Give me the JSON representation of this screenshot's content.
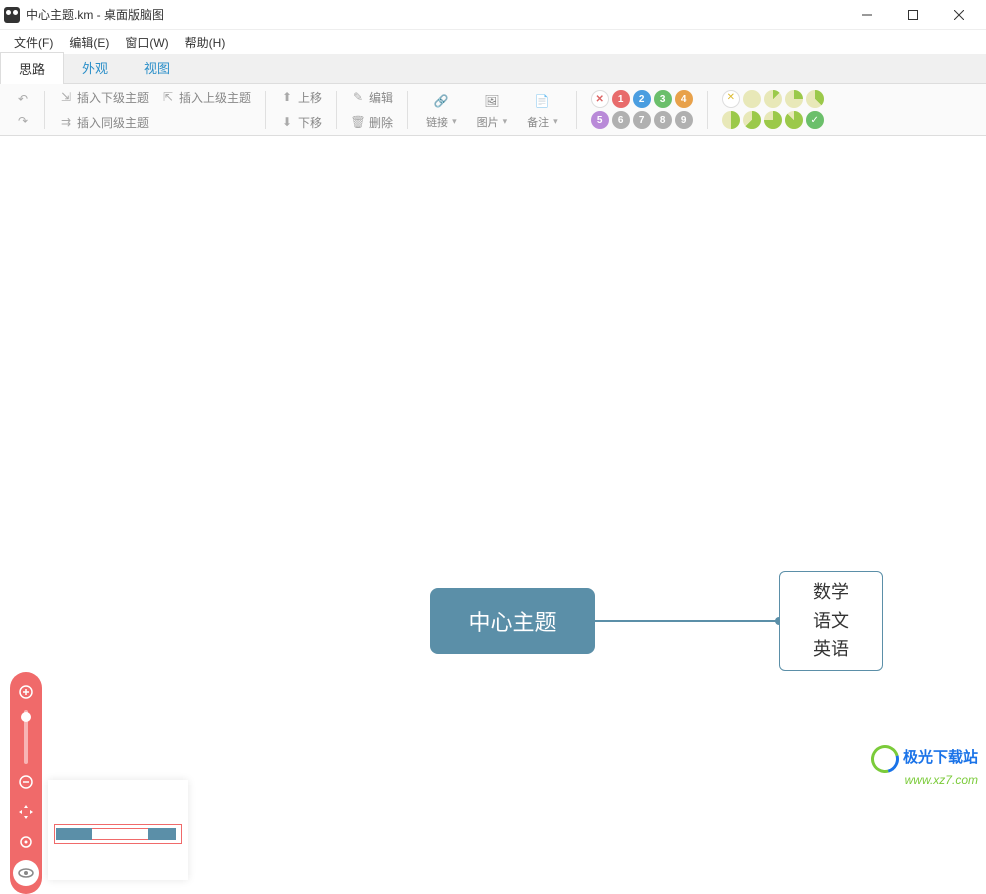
{
  "window": {
    "title": "中心主题.km - 桌面版脑图"
  },
  "menubar": {
    "file": "文件(F)",
    "edit": "编辑(E)",
    "window": "窗口(W)",
    "help": "帮助(H)"
  },
  "tabs": {
    "idea": "思路",
    "appearance": "外观",
    "view": "视图"
  },
  "toolbar": {
    "insert_child": "插入下级主题",
    "insert_parent": "插入上级主题",
    "insert_sibling": "插入同级主题",
    "move_up": "上移",
    "move_down": "下移",
    "edit": "编辑",
    "delete": "删除",
    "link": "链接",
    "image": "图片",
    "note": "备注",
    "priority": {
      "items": [
        "1",
        "2",
        "3",
        "4",
        "5",
        "6",
        "7",
        "8",
        "9"
      ]
    }
  },
  "mindmap": {
    "center": "中心主题",
    "child_lines": [
      "数学",
      "语文",
      "英语"
    ]
  },
  "watermark": {
    "line1": "极光下载站",
    "line2": "www.xz7.com"
  },
  "colors": {
    "node": "#5b8fa8",
    "accent": "#f06a6a",
    "tab_link": "#2b8fc9"
  }
}
